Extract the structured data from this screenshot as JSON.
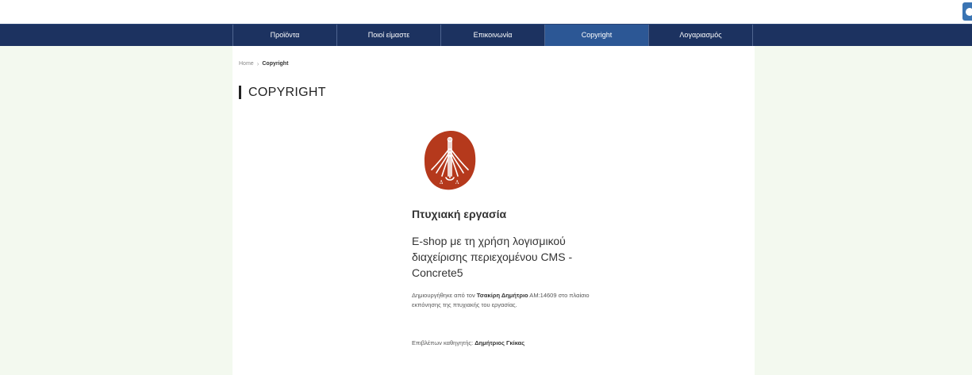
{
  "nav": {
    "items": [
      {
        "label": "Προϊόντα",
        "active": false
      },
      {
        "label": "Ποιοί είμαστε",
        "active": false
      },
      {
        "label": "Επικοινωνία",
        "active": false
      },
      {
        "label": "Copyright",
        "active": true
      },
      {
        "label": "Λογαριασμός",
        "active": false
      }
    ]
  },
  "breadcrumb": {
    "home": "Home",
    "current": "Copyright"
  },
  "page_title": "COPYRIGHT",
  "logo": {
    "icon": "university-seal-icon",
    "color": "#b5391c"
  },
  "thesis": {
    "heading": "Πτυχιακή εργασία",
    "subtitle": "E-shop με τη χρήση λογισμικού διαχείρισης περιεχομένου CMS - Concrete5",
    "credit_prefix": "Δημιουργήθηκε από τον ",
    "author": "Τσακίρη Δημήτριο",
    "credit_suffix": " ΑΜ:14609 στο πλαίσιο εκπόνησης της πτυχιακής του εργασίας.",
    "supervisor_prefix": "Επιβλέπων καθηγητής: ",
    "supervisor": "Δημήτριος Γκίκας"
  },
  "colors": {
    "navbar": "#1c3260",
    "nav_active": "#2c5795",
    "page_bg": "#f3f9ef",
    "seal": "#b5391c"
  }
}
